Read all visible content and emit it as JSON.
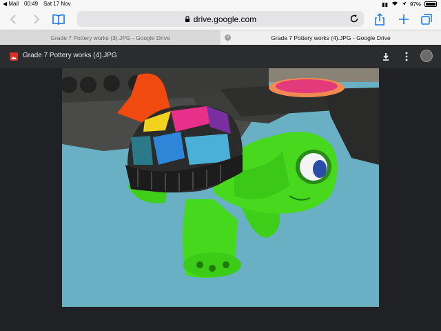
{
  "status": {
    "carrier": "◀ Mail",
    "time": "00:49",
    "date": "Sat 17 Nov",
    "battery": "97%",
    "battery_level": 0.97
  },
  "browser": {
    "url": "drive.google.com",
    "tabs": [
      {
        "label": "Grade 7 Pottery works (3).JPG - Google Drive",
        "active": false
      },
      {
        "label": "Grade 7 Pottery works (4).JPG - Google Drive",
        "active": true
      }
    ]
  },
  "viewer": {
    "file_title": "Grade 7 Pottery works (4).JPG",
    "accent": "#d93025"
  },
  "icons": {
    "back": "chevron-left-icon",
    "forward": "chevron-right-icon",
    "bookmarks": "book-icon",
    "lock": "lock-icon",
    "reload": "reload-icon",
    "share": "share-icon",
    "new_tab": "plus-icon",
    "tabs": "tabs-icon",
    "download": "download-icon",
    "more": "more-vertical-icon"
  }
}
